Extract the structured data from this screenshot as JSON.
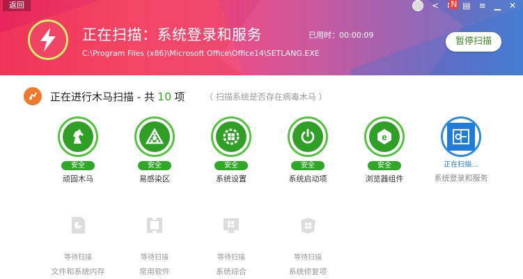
{
  "header": {
    "back_label": "返回",
    "title": "正在扫描：系统登录和服务",
    "path": "C:\\Program Files (x86)\\Microsoft Office\\Office14\\SETLANG.EXE",
    "elapsed": "已用时：00:00:09",
    "pause_label": "暂停扫描",
    "notification_badge": "N"
  },
  "section": {
    "title_prefix": "正在进行木马扫描 - 共",
    "count": "10",
    "title_suffix": "项",
    "hint": "（ 扫描系统是否存在病毒木马 ）"
  },
  "items": [
    {
      "status": "安全",
      "label": "顽固木马",
      "icon": "horse-icon"
    },
    {
      "status": "安全",
      "label": "易感染区",
      "icon": "biohazard-icon"
    },
    {
      "status": "安全",
      "label": "系统设置",
      "icon": "windows-gear-icon"
    },
    {
      "status": "安全",
      "label": "系统启动项",
      "icon": "power-icon"
    },
    {
      "status": "安全",
      "label": "浏览器组件",
      "icon": "browser-icon"
    },
    {
      "status": "正在扫描...",
      "label": "系统登录和服务",
      "icon": "login-service-icon"
    }
  ],
  "waiting": [
    {
      "status": "等待扫描",
      "label": "文件和系统内存",
      "icon": "file-memory-icon"
    },
    {
      "status": "等待扫描",
      "label": "常用软件",
      "icon": "software-icon"
    },
    {
      "status": "等待扫描",
      "label": "系统综合",
      "icon": "system-integrated-icon"
    },
    {
      "status": "等待扫描",
      "label": "系统修复项",
      "icon": "system-repair-icon"
    }
  ],
  "colors": {
    "safe_green": "#2fa827",
    "scanning_blue": "#1f7cd8",
    "accent_orange": "#ef7a2b"
  }
}
